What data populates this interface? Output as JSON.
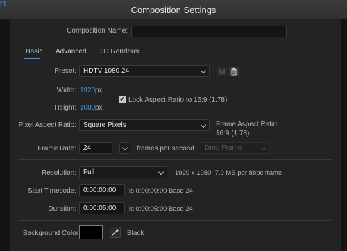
{
  "window": {
    "title": "Composition Settings",
    "peek_text": "nt"
  },
  "comp_name": {
    "label": "Composition Name:",
    "value": ""
  },
  "tabs": [
    {
      "label": "Basic",
      "active": true
    },
    {
      "label": "Advanced",
      "active": false
    },
    {
      "label": "3D Renderer",
      "active": false
    }
  ],
  "preset": {
    "label": "Preset:",
    "value": "HDTV 1080 24"
  },
  "width": {
    "label": "Width:",
    "value": "1920",
    "unit": "px"
  },
  "height": {
    "label": "Height:",
    "value": "1080",
    "unit": "px"
  },
  "lock_aspect": {
    "label": "Lock Aspect Ratio to 16:9 (1.78)",
    "checked": true
  },
  "pixel_aspect": {
    "label": "Pixel Aspect Ratio:",
    "value": "Square Pixels",
    "frame_aspect_label": "Frame Aspect Ratio:",
    "frame_aspect_value": "16:9 (1.78)"
  },
  "frame_rate": {
    "label": "Frame Rate:",
    "value": "24",
    "unit": "frames per second",
    "drop_frame": "Drop Frame"
  },
  "resolution": {
    "label": "Resolution:",
    "value": "Full",
    "info": "1920 x 1080, 7.9 MB per 8bpc frame"
  },
  "start_timecode": {
    "label": "Start Timecode:",
    "value": "0:00:00:00",
    "info": "is 0:00:00:00  Base 24"
  },
  "duration": {
    "label": "Duration:",
    "value": "0:00:05:00",
    "info": "is 0:00:05:00  Base 24"
  },
  "background": {
    "label": "Background Color:",
    "color": "#000000",
    "name": "Black"
  },
  "colors": {
    "accent": "#3b95e8",
    "panel": "#232323",
    "field": "#151515"
  }
}
